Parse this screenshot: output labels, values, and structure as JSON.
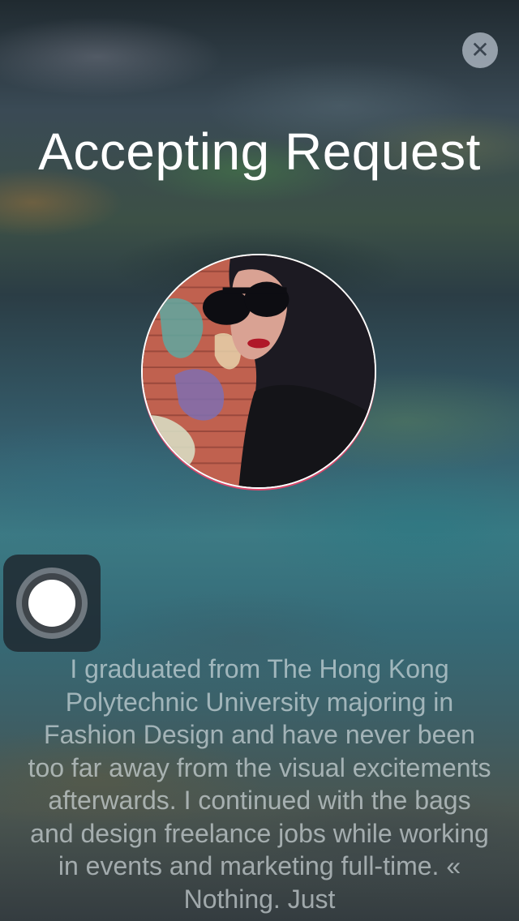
{
  "header": {
    "title": "Accepting Request",
    "close_icon": "close-icon",
    "close_glyph": "✕"
  },
  "profile": {
    "avatar_icon": "avatar",
    "bio": "I graduated from The Hong Kong Polytechnic University majoring in Fashion Design and have never been too far away from the visual excitements afterwards. I continued with the bags and design freelance jobs while working in events and marketing full-time. « Nothing. Just"
  },
  "overlay": {
    "assistive_touch_icon": "assistive-touch-icon"
  },
  "colors": {
    "title": "#ffffff",
    "close_bg": "#bec8d2",
    "avatar_border": "#ffffff",
    "avatar_accent": "#e0466a",
    "bio_text": "#e1e8ec"
  }
}
